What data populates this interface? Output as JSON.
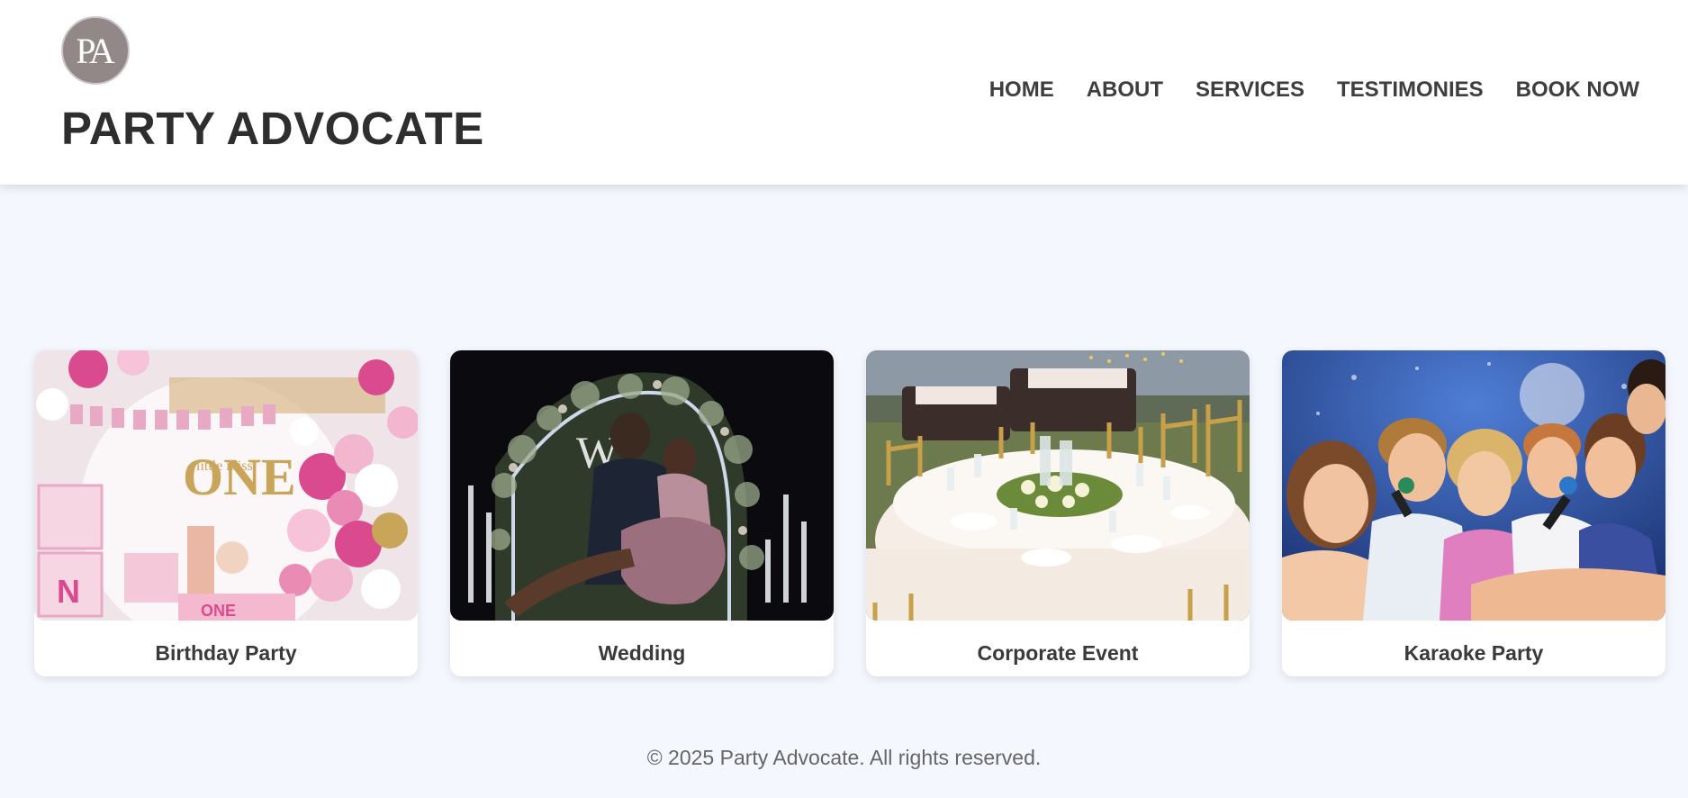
{
  "brand": {
    "logo_text": "PA",
    "title": "PARTY ADVOCATE"
  },
  "nav": [
    {
      "label": "HOME"
    },
    {
      "label": "ABOUT"
    },
    {
      "label": "SERVICES"
    },
    {
      "label": "TESTIMONIES"
    },
    {
      "label": "BOOK NOW"
    }
  ],
  "cards": [
    {
      "title": "Birthday Party",
      "image": "birthday-photo"
    },
    {
      "title": "Wedding",
      "image": "wedding-photo"
    },
    {
      "title": "Corporate Event",
      "image": "corporate-event-photo"
    },
    {
      "title": "Karaoke Party",
      "image": "karaoke-photo"
    }
  ],
  "footer": {
    "text": "© 2025 Party Advocate. All rights reserved."
  },
  "colors": {
    "page_background": "#f4f7fd",
    "header_background": "#ffffff",
    "logo_badge": "#938888",
    "text_dark": "#2e2e2e"
  }
}
